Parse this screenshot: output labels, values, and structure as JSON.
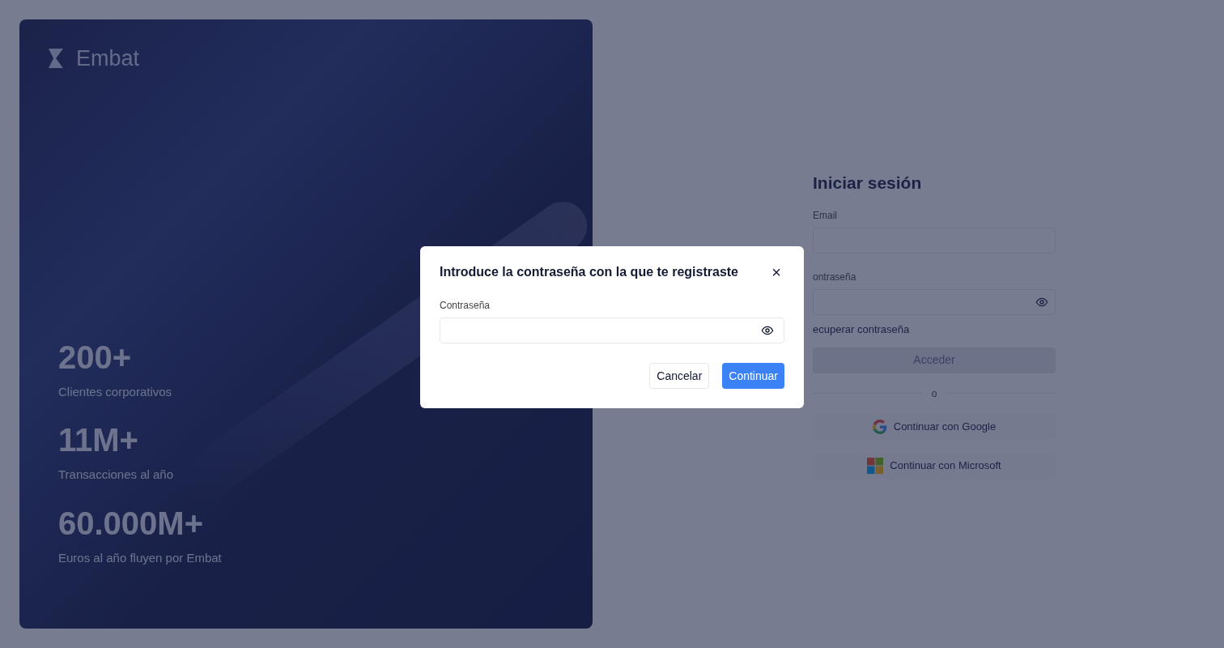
{
  "brand": {
    "name": "Embat"
  },
  "stats": [
    {
      "value": "200+",
      "label": "Clientes corporativos"
    },
    {
      "value": "11M+",
      "label": "Transacciones al año"
    },
    {
      "value": "60.000M+",
      "label": "Euros al año fluyen por Embat"
    }
  ],
  "login": {
    "title": "Iniciar sesión",
    "email_label": "Email",
    "password_label": "ontraseña",
    "recover_link": "ecuperar contraseña",
    "submit": {
      "label": "Acceder",
      "disabled": true
    },
    "divider": "o",
    "providers": [
      {
        "kind": "google",
        "label": "Continuar con Google"
      },
      {
        "kind": "microsoft",
        "label": "Continuar con Microsoft"
      }
    ]
  },
  "dialog": {
    "title": "Introduce la contraseña con la que te registraste",
    "close": "×",
    "field_label": "Contraseña",
    "cancel": "Cancelar",
    "confirm": "Continuar"
  }
}
